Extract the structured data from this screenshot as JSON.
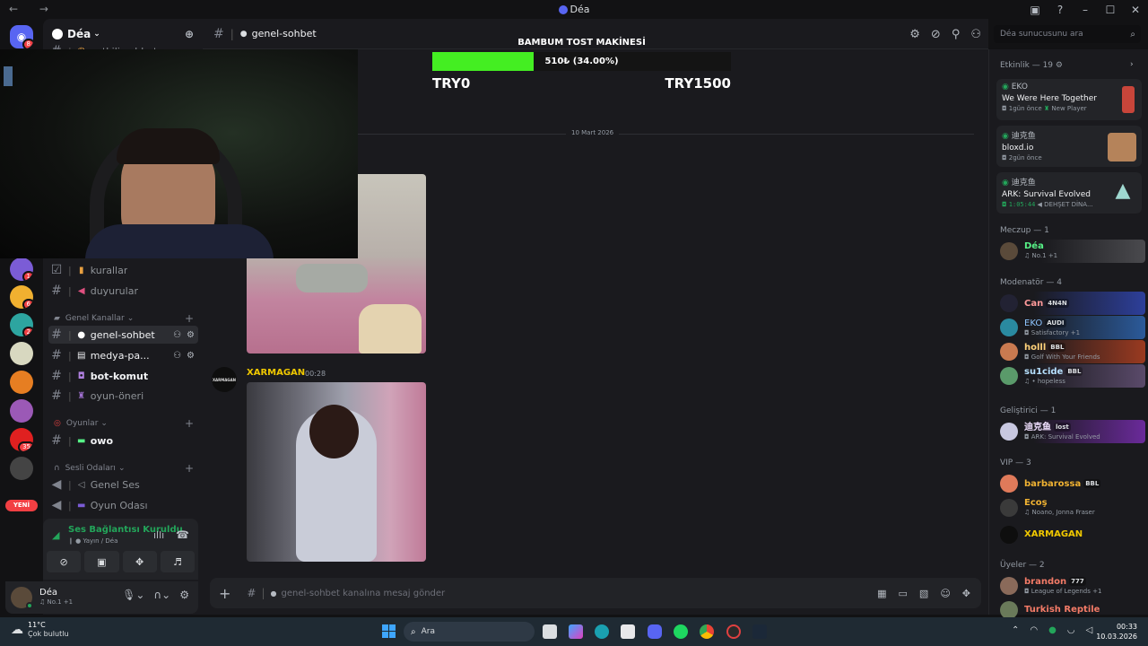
{
  "window": {
    "title": "Déa"
  },
  "rail": {
    "new_label": "YENİ",
    "badges": [
      "8",
      "1",
      "6",
      "2",
      "35"
    ]
  },
  "guild": {
    "name": "Déa"
  },
  "channels": {
    "top": {
      "label": "yetkili-sohbet"
    },
    "rules": {
      "label": "kurallar"
    },
    "announce": {
      "label": "duyurular"
    },
    "cat_general": "Genel Kanallar",
    "general": {
      "label": "genel-sohbet"
    },
    "media": {
      "label": "medya-pa..."
    },
    "bot": {
      "label": "bot-komut"
    },
    "game_suggest": {
      "label": "oyun-öneri"
    },
    "cat_games": "Oyunlar",
    "owo": {
      "label": "owo"
    },
    "cat_voice": "Sesli Odaları",
    "voice_general": {
      "label": "Genel Ses"
    },
    "voice_game": {
      "label": "Oyun Odası"
    }
  },
  "voice_panel": {
    "status": "Ses Bağlantısı Kuruldu",
    "sub": "Yayın / Déa"
  },
  "user_panel": {
    "name": "Déa",
    "status": "No.1 +1"
  },
  "chat": {
    "channel_name": "genel-sohbet",
    "donation": {
      "title": "BAMBUM TOST MAKİNESİ",
      "progress_text": "510₺ (34.00%)",
      "progress": 0.34,
      "min": "TRY0",
      "max": "TRY1500"
    },
    "date_divider": "10 Mart 2026",
    "message": {
      "author": "XARMAGAN",
      "time": "00:28",
      "avatar_text": "XARMAGAN"
    },
    "input_placeholder": "genel-sohbet kanalına mesaj gönder"
  },
  "search": {
    "placeholder": "Déa sunucusunu ara"
  },
  "activity": {
    "header": "Etkinlik — 19",
    "items": [
      {
        "user": "EKO",
        "game": "We Were Here Together",
        "meta1": "1gün önce",
        "meta2": "New Player"
      },
      {
        "user": "迪克鱼",
        "game": "bloxd.io",
        "meta1": "2gün önce",
        "meta2": ""
      },
      {
        "user": "迪克鱼",
        "game": "ARK: Survival Evolved",
        "meta1": "1:05:44",
        "meta2": "DEHŞET DİNA..."
      }
    ]
  },
  "members": {
    "g_mezcup": "Meczup — 1",
    "g_mod": "Modenatör — 4",
    "g_dev": "Geliştirici — 1",
    "g_vip": "VIP — 3",
    "g_users": "Üyeler — 2",
    "list": [
      {
        "name": "Déa",
        "sub": "No.1 +1",
        "tag": "",
        "color": "#57f287"
      },
      {
        "name": "Can",
        "sub": "",
        "tag": "4N4N",
        "color": "#ff7a7a"
      },
      {
        "name": "EKO",
        "sub": "Satisfactory +1",
        "tag": "AUDI",
        "color": "#8ec5ff"
      },
      {
        "name": "holll",
        "sub": "Golf With Your Friends",
        "tag": "BBL",
        "color": "#ffb347"
      },
      {
        "name": "su1cide",
        "sub": "hopeless",
        "tag": "BBL",
        "color": "#9fd3ff"
      },
      {
        "name": "迪克鱼",
        "sub": "ARK: Survival Evolved",
        "tag": "lost",
        "color": "#e3c8ff"
      },
      {
        "name": "barbarossa",
        "sub": "",
        "tag": "BBL",
        "color": "#f0b232"
      },
      {
        "name": "Ecoş",
        "sub": "Noano, Jonna Fraser",
        "tag": "",
        "color": "#f0b232"
      },
      {
        "name": "XARMAGAN",
        "sub": "",
        "tag": "",
        "color": "#f0c800"
      },
      {
        "name": "brandon",
        "sub": "League of Legends +1",
        "tag": "777",
        "color": "#f47b67"
      },
      {
        "name": "Turkish Reptile",
        "sub": "",
        "tag": "",
        "color": "#f47b67"
      }
    ]
  },
  "taskbar": {
    "weather_temp": "11°C",
    "weather_desc": "Çok bulutlu",
    "search": "Ara",
    "time": "00:33",
    "date": "10.03.2026"
  }
}
